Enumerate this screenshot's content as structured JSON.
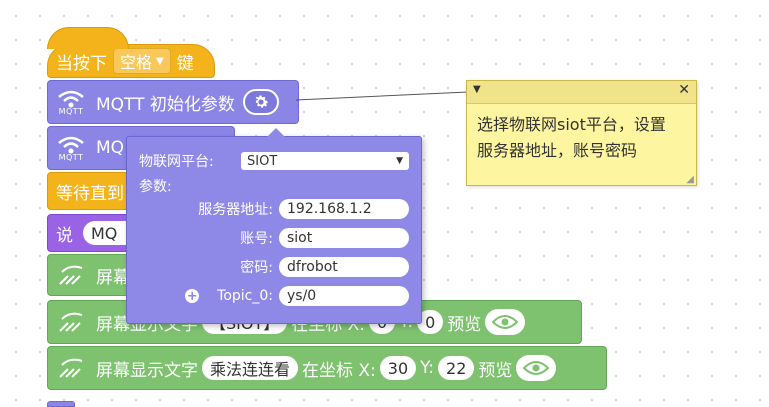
{
  "blocks": {
    "hat": {
      "prefix": "当按下",
      "key": "空格",
      "suffix": "键"
    },
    "mqtt_init": {
      "icon_label": "MQTT",
      "label": "MQTT 初始化参数"
    },
    "mqtt_second": {
      "icon_label": "MQTT",
      "label": "MQ"
    },
    "wait": {
      "label": "等待直到"
    },
    "say": {
      "label": "说",
      "pill": "MQ"
    },
    "screen1": {
      "label": "屏幕"
    },
    "screen2": {
      "label": "屏幕显示文字",
      "text": "【SIOT】",
      "coord": "在坐标 X:",
      "x": "0",
      "y_label": "Y:",
      "y": "0",
      "preview": "预览"
    },
    "screen3": {
      "label": "屏幕显示文字",
      "text": "乘法连连看",
      "coord": "在坐标 X:",
      "x": "30",
      "y_label": "Y:",
      "y": "22",
      "preview": "预览"
    }
  },
  "popup": {
    "platform_label": "物联网平台:",
    "platform_value": "SIOT",
    "params_label": "参数:",
    "server_label": "服务器地址:",
    "server_value": "192.168.1.2",
    "account_label": "账号:",
    "account_value": "siot",
    "password_label": "密码:",
    "password_value": "dfrobot",
    "topic_label": "Topic_0:",
    "topic_value": "ys/0"
  },
  "comment": {
    "text_line1": "选择物联网siot平台，设置",
    "text_line2": "服务器地址，账号密码"
  },
  "colors": {
    "event": "#f5b31b",
    "mqtt": "#8b86e6",
    "looks": "#9a63e6",
    "screen": "#7ec16f",
    "comment": "#fef5a0"
  }
}
